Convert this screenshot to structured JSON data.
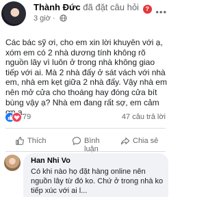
{
  "post": {
    "author": "Thành Đức",
    "action": "đã đặt câu hỏi",
    "time": "3 giờ",
    "body": "Các bác sỹ ơi, cho em xin lời khuyên với ạ, xóm em có 2 nhà dương tính không rõ nguồn lây vì luôn ở trong nhà không giao tiếp với ai. Mà 2 nhà đấy ở sát vách với nhà em, nhà em kẹt giữa 2 nhà đấy.  Vậy nhà em nên mở cửa cho thoáng hay đóng cửa bít bùng vậy ạ? Nhà em đang rất sợ, em cảm ơn ạ.",
    "reaction_count": "79",
    "comment_count": "47 câu trả lời"
  },
  "actions": {
    "like_label": "Thích",
    "comment_label": "Bình luận",
    "share_label": "Chia sẻ"
  },
  "comment": {
    "author": "Han Nhi Vo",
    "text": "Có khi nào họ đặt hàng online nên nguồn lây từ đó ko. Chứ ở trong nhà ko tiếp xúc với ai l..."
  },
  "colors": {
    "question_badge": "#e4363b",
    "like_reaction": "#1877f2",
    "love_reaction": "#f33e58",
    "comment_bubble": "#f0f2f5"
  },
  "icons": {
    "privacy": "globe-icon",
    "more": "more-dots-icon",
    "like": "thumbs-up-icon",
    "comment": "speech-bubble-icon",
    "share": "share-arrow-icon"
  }
}
